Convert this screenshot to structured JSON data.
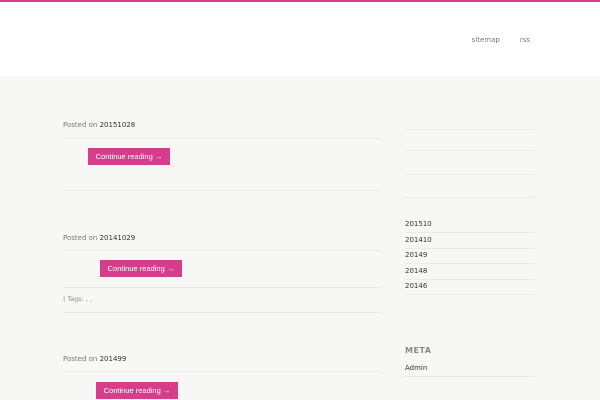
{
  "colors": {
    "accent": "#d63e8c",
    "background": "#f7f7f5",
    "header_bg": "#ffffff"
  },
  "nav": {
    "items": [
      {
        "label": "sitemap"
      },
      {
        "label": "rss"
      }
    ]
  },
  "posts": [
    {
      "meta_prefix": "Posted on",
      "date": "20151028",
      "button": "Continue reading →"
    },
    {
      "meta_prefix": "Posted on",
      "date": "20141029",
      "button": "Continue reading →",
      "tags": "| Tags: , ,"
    },
    {
      "meta_prefix": "Posted on",
      "date": "201499",
      "button": "Continue reading →"
    }
  ],
  "sidebar": {
    "archives": [
      "201510",
      "201410",
      "20149",
      "20148",
      "20146"
    ],
    "meta_title": "META",
    "meta_items": [
      "Admin"
    ]
  }
}
